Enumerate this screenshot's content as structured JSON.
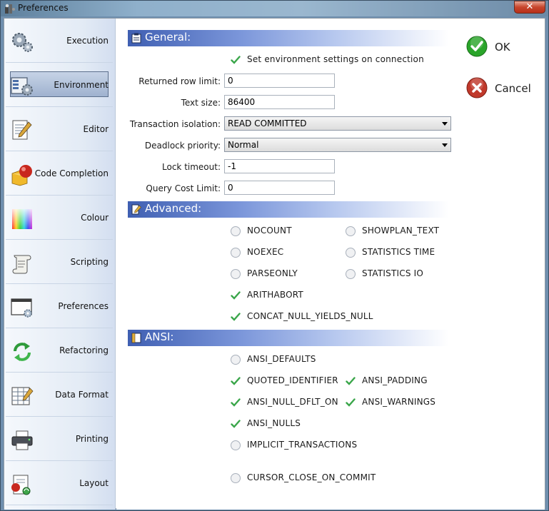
{
  "window": {
    "title": "Preferences",
    "close_symbol": "✕"
  },
  "sidebar": {
    "items": [
      {
        "label": "Execution",
        "icon": "gears-icon",
        "selected": false
      },
      {
        "label": "Environment",
        "icon": "environment-icon",
        "selected": true
      },
      {
        "label": "Editor",
        "icon": "editor-icon",
        "selected": false
      },
      {
        "label": "Code Completion",
        "icon": "code-completion-icon",
        "selected": false
      },
      {
        "label": "Colour",
        "icon": "colour-icon",
        "selected": false
      },
      {
        "label": "Scripting",
        "icon": "scroll-icon",
        "selected": false
      },
      {
        "label": "Preferences",
        "icon": "preferences-window-icon",
        "selected": false
      },
      {
        "label": "Refactoring",
        "icon": "refresh-arrows-icon",
        "selected": false
      },
      {
        "label": "Data Format",
        "icon": "data-grid-icon",
        "selected": false
      },
      {
        "label": "Printing",
        "icon": "printer-icon",
        "selected": false
      },
      {
        "label": "Layout",
        "icon": "layout-icon",
        "selected": false
      }
    ]
  },
  "general": {
    "title": "General:",
    "set_env": {
      "label": "Set environment settings on connection",
      "checked": true
    },
    "fields": {
      "row_limit": {
        "label": "Returned row limit:",
        "value": "0"
      },
      "text_size": {
        "label": "Text size:",
        "value": "86400"
      },
      "isolation": {
        "label": "Transaction isolation:",
        "value": "READ COMMITTED"
      },
      "deadlock": {
        "label": "Deadlock priority:",
        "value": "Normal"
      },
      "lock_timeout": {
        "label": "Lock timeout:",
        "value": "-1"
      },
      "query_cost": {
        "label": "Query Cost Limit:",
        "value": "0"
      }
    }
  },
  "advanced": {
    "title": "Advanced:",
    "options": [
      {
        "label": "NOCOUNT",
        "checked": false
      },
      {
        "label": "SHOWPLAN_TEXT",
        "checked": false
      },
      {
        "label": "NOEXEC",
        "checked": false
      },
      {
        "label": "STATISTICS TIME",
        "checked": false
      },
      {
        "label": "PARSEONLY",
        "checked": false
      },
      {
        "label": "STATISTICS IO",
        "checked": false
      },
      {
        "label": "ARITHABORT",
        "checked": true
      },
      {
        "label": "CONCAT_NULL_YIELDS_NULL",
        "checked": true
      }
    ]
  },
  "ansi": {
    "title": "ANSI:",
    "options": [
      {
        "label": "ANSI_DEFAULTS",
        "checked": false
      },
      {
        "label": "QUOTED_IDENTIFIER",
        "checked": true
      },
      {
        "label": "ANSI_PADDING",
        "checked": true
      },
      {
        "label": "ANSI_NULL_DFLT_ON",
        "checked": true
      },
      {
        "label": "ANSI_WARNINGS",
        "checked": true
      },
      {
        "label": "ANSI_NULLS",
        "checked": true
      },
      {
        "label": "IMPLICIT_TRANSACTIONS",
        "checked": false
      },
      {
        "label": "CURSOR_CLOSE_ON_COMMIT",
        "checked": false
      }
    ]
  },
  "actions": {
    "ok_label": "OK",
    "cancel_label": "Cancel"
  },
  "colors": {
    "ok_green": "#2aa52a",
    "cancel_red": "#c0392b",
    "check_green": "#3aa64a",
    "header_blue": "#3f5fb2"
  }
}
